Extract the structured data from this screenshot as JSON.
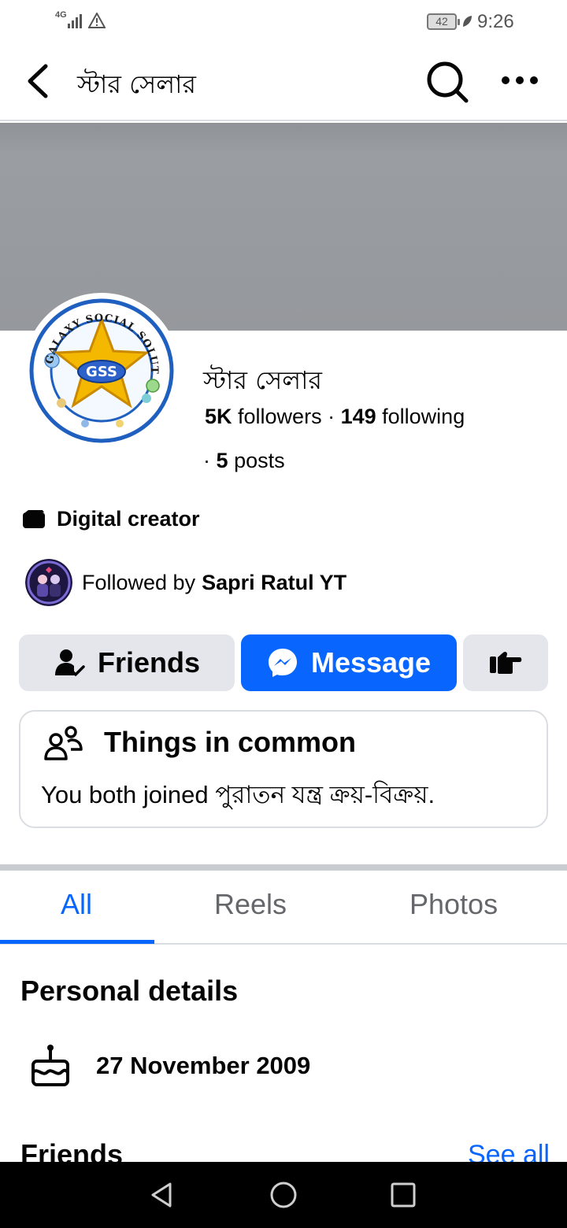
{
  "status_bar": {
    "network": "4G",
    "battery": "42",
    "time": "9:26"
  },
  "header": {
    "title": "স্টার সেলার"
  },
  "profile": {
    "name": "স্টার সেলার",
    "followers_count": "5K",
    "followers_label": "followers ·",
    "following_count": "149",
    "following_label": "following",
    "posts_prefix": "·",
    "posts_count": "5",
    "posts_label": "posts",
    "category": "Digital creator",
    "followed_by_prefix": "Followed by",
    "followed_by_name": "Sapri Ratul YT",
    "avatar_ring_text": "GALAXY SOCIAL SOLUTION",
    "avatar_center_text": "GSS"
  },
  "actions": {
    "friends_label": "Friends",
    "message_label": "Message"
  },
  "common": {
    "title": "Things in common",
    "text": "You both joined পুরাতন যন্ত্র ক্রয়-বিক্রয়."
  },
  "tabs": [
    {
      "label": "All",
      "active": true
    },
    {
      "label": "Reels",
      "active": false
    },
    {
      "label": "Photos",
      "active": false
    }
  ],
  "details": {
    "title": "Personal details",
    "birthday": "27 November 2009"
  },
  "friends": {
    "title": "Friends",
    "see_all": "See all"
  },
  "colors": {
    "accent": "#0866ff",
    "button_gray": "#e4e6eb",
    "cover": "#95989c"
  }
}
